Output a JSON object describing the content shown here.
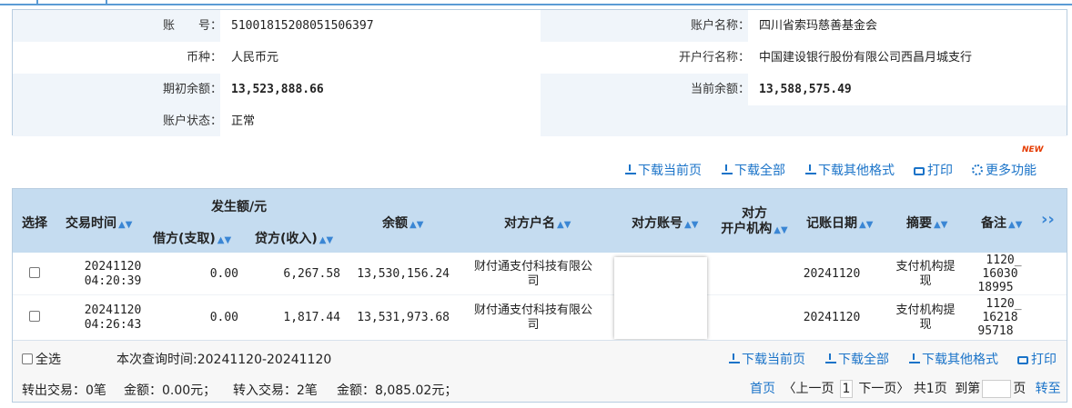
{
  "account": {
    "no_label": "账　　号：",
    "no_value": "51001815208051506397",
    "name_label": "账户名称：",
    "name_value": "四川省索玛慈善基金会",
    "currency_label": "币种：",
    "currency_value": "人民币元",
    "bank_label": "开户行名称：",
    "bank_value": "中国建设银行股份有限公司西昌月城支行",
    "opening_label": "期初余额：",
    "opening_value": "13,523,888.66",
    "current_label": "当前余额：",
    "current_value": "13,588,575.49",
    "status_label": "账户状态：",
    "status_value": "正常"
  },
  "toolbar": {
    "download_current": "下载当前页",
    "download_all": "下载全部",
    "download_other": "下载其他格式",
    "print": "打印",
    "more": "更多功能",
    "new_badge": "NEW"
  },
  "table": {
    "headers": {
      "select": "选择",
      "time": "交易时间",
      "amount_group": "发生额/元",
      "debit": "借方(支取)",
      "credit": "贷方(收入)",
      "balance": "余额",
      "counterparty_name": "对方户名",
      "counterparty_account": "对方账号",
      "counterparty_bank_line1": "对方",
      "counterparty_bank_line2": "开户机构",
      "post_date": "记账日期",
      "summary": "摘要",
      "remark": "备注",
      "more": "››"
    },
    "rows": [
      {
        "date": "20241120",
        "time": "04:20:39",
        "debit": "0.00",
        "credit": "6,267.58",
        "balance": "13,530,156.24",
        "counterparty_line1": "财付通支付科技有限公",
        "counterparty_line2": "司",
        "post_date": "20241120",
        "summary_line1": "支付机构提",
        "summary_line2": "现",
        "remark_line1": "1120_",
        "remark_line2": "16030",
        "remark_line3": "18995"
      },
      {
        "date": "20241120",
        "time": "04:26:43",
        "debit": "0.00",
        "credit": "1,817.44",
        "balance": "13,531,973.68",
        "counterparty_line1": "财付通支付科技有限公",
        "counterparty_line2": "司",
        "post_date": "20241120",
        "summary_line1": "支付机构提",
        "summary_line2": "现",
        "remark_line1": "1120_",
        "remark_line2": "16218",
        "remark_line3": "95718"
      }
    ]
  },
  "footer": {
    "select_all": "全选",
    "query_time": "本次查询时间:20241120-20241120",
    "download_current": "下载当前页",
    "download_all": "下载全部",
    "download_other": "下载其他格式",
    "print": "打印",
    "out_summary": "转出交易：0笔",
    "out_amount": "金额：0.00元；",
    "in_summary": "转入交易：2笔",
    "in_amount": "金额：8,085.02元；",
    "first_page": "首页",
    "prev_page": "〈上一页",
    "page_no": "1",
    "next_page": "下一页〉",
    "total_pages": "共1页",
    "goto_label": "到第",
    "page_unit": "页",
    "goto_button": "转至"
  }
}
